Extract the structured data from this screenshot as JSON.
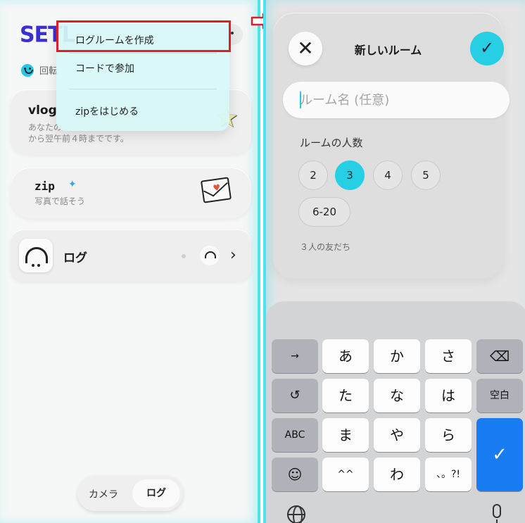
{
  "left": {
    "logo": "SETL",
    "top_button": "•",
    "notice_text": "回転",
    "dropdown": {
      "items": [
        "ログルームを作成",
        "コードで参加",
        "zipをはじめる"
      ]
    },
    "vlog_card": {
      "title": "vlog",
      "desc_line1": "あなたの",
      "desc_line2": "から翌午前４時までです。"
    },
    "zip_card": {
      "title": "zip",
      "spark": "✦",
      "desc": "写真で話そう"
    },
    "log_card": {
      "title": "ログ",
      "chevron": "›"
    },
    "bottom_toggle": {
      "camera": "カメラ",
      "log": "ログ"
    }
  },
  "right": {
    "dialog": {
      "close_glyph": "✕",
      "title": "新しいルーム",
      "confirm_glyph": "✓",
      "room_name_placeholder": "ルーム名 (任意)",
      "size_label": "ルームの人数",
      "sizes": [
        "2",
        "3",
        "4",
        "5",
        "6-20"
      ],
      "selected_size": "3",
      "friends_text": "３人の友だち"
    },
    "keyboard": {
      "row1": [
        "→",
        "あ",
        "か",
        "さ",
        "⌫"
      ],
      "row2": [
        "↺",
        "た",
        "な",
        "は",
        "空白"
      ],
      "row3": [
        "ABC",
        "ま",
        "や",
        "ら"
      ],
      "row4": [
        "☺",
        "^^",
        "わ",
        "、。?!"
      ],
      "enter": "✓"
    }
  },
  "colors": {
    "accent": "#27cfe5",
    "highlight": "#e01d2b",
    "logo": "#3b2fd1",
    "enter": "#1a7cf3"
  }
}
